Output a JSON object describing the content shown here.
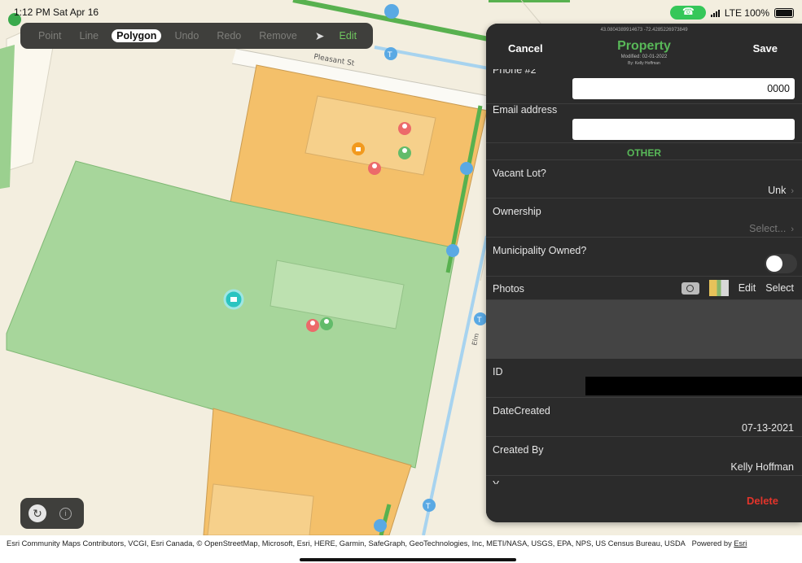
{
  "status_bar": {
    "time": "1:12 PM  Sat Apr 16",
    "network": "LTE 100%"
  },
  "toolbar": {
    "point": "Point",
    "line": "Line",
    "polygon": "Polygon",
    "undo": "Undo",
    "redo": "Redo",
    "remove": "Remove",
    "edit": "Edit",
    "selected": "Polygon"
  },
  "map": {
    "street_label": "Pleasant St",
    "street_label_2": "Elm"
  },
  "panel": {
    "coordinates": "43.0804389914673 -72.4285226973849",
    "title": "Property",
    "modified": "Modified: 02-01-2022",
    "by": "By: Kelly Hoffman",
    "cancel": "Cancel",
    "save": "Save",
    "delete": "Delete",
    "fields": {
      "phone_label": "Phone #2",
      "phone_value": "0000",
      "email_label": "Email address",
      "email_value": "",
      "section_other": "OTHER",
      "vacant_label": "Vacant Lot?",
      "vacant_value": "Unk",
      "ownership_label": "Ownership",
      "ownership_value": "Select...",
      "municipality_label": "Municipality Owned?",
      "municipality_value": false,
      "photos_label": "Photos",
      "photos_edit": "Edit",
      "photos_select": "Select",
      "id_label": "ID",
      "datecreated_label": "DateCreated",
      "datecreated_value": "07-13-2021",
      "createdby_label": "Created By",
      "createdby_value": "Kelly Hoffman",
      "next_label": "Y"
    }
  },
  "attribution": "Esri Community Maps Contributors, VCGI, Esri Canada, © OpenStreetMap, Microsoft, Esri, HERE, Garmin, SafeGraph, GeoTechnologies, Inc, METI/NASA, USGS, EPA, NPS, US Census Bureau, USDA",
  "powered_by": "Powered by ",
  "powered_by_link": "Esri",
  "colors": {
    "accent_green": "#58b858",
    "delete_red": "#e3342b",
    "parcel_orange": "#f5c16f",
    "parcel_green": "#a8d79c"
  }
}
